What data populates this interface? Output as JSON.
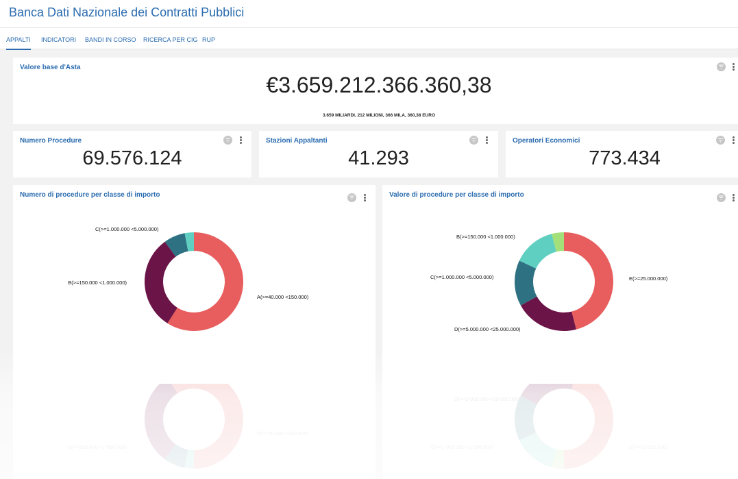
{
  "app": {
    "title": "Banca Dati Nazionale dei Contratti Pubblici"
  },
  "tabs": [
    {
      "label": "APPALTI",
      "active": true
    },
    {
      "label": "INDICATORI",
      "active": false
    },
    {
      "label": "BANDI IN CORSO",
      "active": false
    },
    {
      "label": "RICERCA PER CIG",
      "active": false
    },
    {
      "label": "RUP",
      "active": false
    }
  ],
  "valore_base": {
    "title": "Valore base d'Asta",
    "value": "€3.659.212.366.360,38",
    "words": "3.659 MILIARDI, 212 MILIONI, 366 MILA, 360,38 EURO"
  },
  "kpis": [
    {
      "title": "Numero Procedure",
      "value": "69.576.124"
    },
    {
      "title": "Stazioni Appaltanti",
      "value": "41.293"
    },
    {
      "title": "Operatori Economici",
      "value": "773.434"
    }
  ],
  "icons": {
    "filter": "filter-icon",
    "more": "more-vert-icon"
  },
  "colors": {
    "accent": "#2b6cb0",
    "A": "#e85d5d",
    "B": "#6b1447",
    "C": "#2e7182",
    "D": "#5ecfc0",
    "E": "#a3e07a"
  },
  "chart_data": [
    {
      "type": "pie",
      "title": "Numero di procedure per classe di importo",
      "donut": true,
      "slices": [
        {
          "label": "A(>=40.000 <150.000)",
          "value": 0.59,
          "color": "#e85d5d"
        },
        {
          "label": "B(>=150.000 <1.000.000)",
          "value": 0.31,
          "color": "#6b1447"
        },
        {
          "label": "C(>=1.000.000 <5.000.000)",
          "value": 0.07,
          "color": "#2e7182"
        },
        {
          "label": "",
          "value": 0.03,
          "color": "#5ecfc0"
        }
      ]
    },
    {
      "type": "pie",
      "title": "Valore di procedure per classe di importo",
      "donut": true,
      "slices": [
        {
          "label": "E(>=25.000.000)",
          "value": 0.46,
          "color": "#e85d5d"
        },
        {
          "label": "D(>=5.000.000 <25.000.000)",
          "value": 0.21,
          "color": "#6b1447"
        },
        {
          "label": "C(>=1.000.000 <5.000.000)",
          "value": 0.15,
          "color": "#2e7182"
        },
        {
          "label": "B(>=150.000 <1.000.000)",
          "value": 0.14,
          "color": "#5ecfc0"
        },
        {
          "label": "",
          "value": 0.04,
          "color": "#a3e07a"
        }
      ]
    }
  ]
}
